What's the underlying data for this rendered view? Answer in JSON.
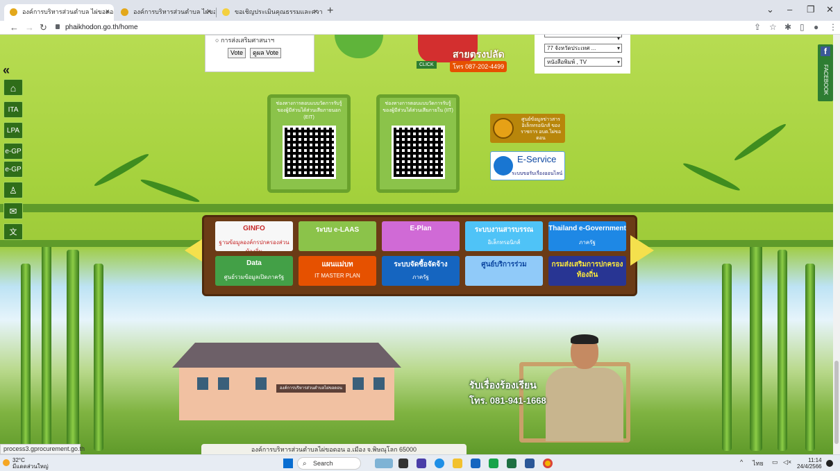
{
  "browser": {
    "tabs": [
      {
        "label": "องค์การบริหารส่วนตำบล ไผ่ขอดอน อ.เ",
        "active": true
      },
      {
        "label": "องค์การบริหารส่วนตำบล ไผ่ขอดอน อ.",
        "active": false
      },
      {
        "label": "ขอเชิญประเมินคุณธรรมและความโปร่งใ",
        "active": false
      }
    ],
    "url": "phaikhodon.go.th/home"
  },
  "page": {
    "vote": {
      "option_label": "การส่งเสริมศาสนาฯ",
      "vote_button": "Vote",
      "results_button": "ดูผล Vote"
    },
    "hotline_banner": {
      "title": "สายตรงปลัด",
      "phone": "โทร 087-202-4499",
      "click": "CLICK"
    },
    "selects": {
      "province": "77 จังหวัดประเทศ ...",
      "newspaper": "หนังสือพิมพ์ , TV"
    },
    "qr_left_caption": "ช่องทางการตอบแบบวัดการรับรู้ของผู้มีส่วนได้ส่วนเสียภายนอก (EIT)",
    "qr_right_caption": "ช่องทางการตอบแบบวัดการรับรู้ของผู้มีส่วนได้ส่วนเสียภายใน (IIT)",
    "info_center": "ศูนย์ข้อมูลข่าวสารอิเล็กทรอนิกส์ ของราชการ อบต.ไผ่ขอดอน",
    "eservice": {
      "title": "E-Service",
      "subtitle": "ระบบขอรับเรื่องออนไลน์"
    },
    "links": [
      {
        "t1": "GINFO",
        "t2": "ฐานข้อมูลองค์กรปกครองส่วนท้องถิ่น",
        "bg": "#f7f7f7",
        "color": "#c62828"
      },
      {
        "t1": "ระบบ e-LAAS",
        "t2": "",
        "bg": "#8bc34a",
        "color": "#ffffff"
      },
      {
        "t1": "E-Plan",
        "t2": "",
        "bg": "#d06ad6",
        "color": "#ffffff"
      },
      {
        "t1": "ระบบงานสารบรรณ",
        "t2": "อิเล็กทรอนิกส์",
        "bg": "#4fc3f7",
        "color": "#ffffff"
      },
      {
        "t1": "Thailand e-Government",
        "t2": "ภาครัฐ",
        "bg": "#1e88e5",
        "color": "#ffffff"
      },
      {
        "t1": "Data",
        "t2": "ศูนย์รวมข้อมูลเปิดภาครัฐ",
        "bg": "#43a047",
        "color": "#ffffff"
      },
      {
        "t1": "แผนแม่บท",
        "t2": "IT MASTER PLAN",
        "bg": "#e65100",
        "color": "#ffffff"
      },
      {
        "t1": "ระบบจัดซื้อจัดจ้าง",
        "t2": "ภาครัฐ",
        "bg": "#1565c0",
        "color": "#ffffff"
      },
      {
        "t1": "ศูนย์บริการร่วม",
        "t2": "",
        "bg": "#90caf9",
        "color": "#0d47a1"
      },
      {
        "t1": "กรมส่งเสริมการปกครองท้องถิ่น",
        "t2": "",
        "bg": "#283593",
        "color": "#ffeb3b"
      }
    ],
    "building_sign": "องค์การบริหารส่วนตำบลไผ่ขอดอน",
    "complaint": {
      "title": "รับเรื่องร้องเรียน",
      "phone": "โทร. 081-941-1668"
    },
    "footer_text": "องค์การบริหารส่วนตำบลไผ่ขอดอน อ.เมือง จ.พิษณุโลก 65000",
    "status_url": "process3.gprocurement.go.th",
    "left_rail": [
      "ITA",
      "LPA",
      "e-GP",
      "e-GP"
    ],
    "facebook": "FACEBOOK"
  },
  "taskbar": {
    "temp": "32°C",
    "weather": "มีแดดส่วนใหญ่",
    "search_placeholder": "Search",
    "lang": "ไทย",
    "time": "11:14",
    "date": "24/4/2566"
  }
}
